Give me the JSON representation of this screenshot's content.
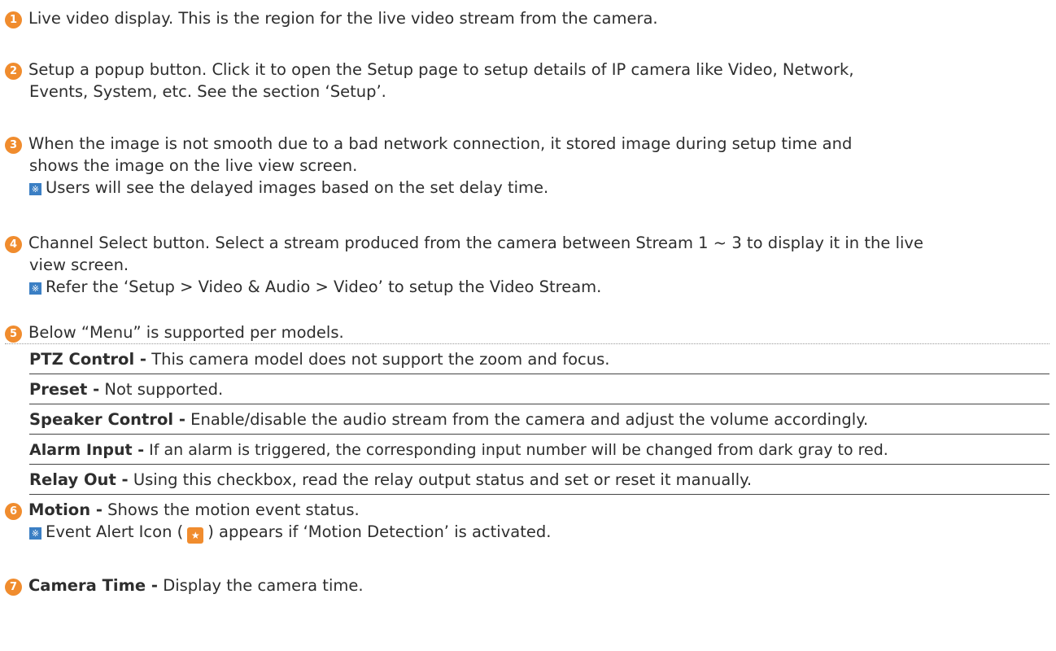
{
  "colors": {
    "number_badge": "#f08c2e",
    "note_icon": "#3b7fc4",
    "alert_icon": "#f08c2e",
    "text": "#2e2e2e"
  },
  "icons": {
    "number_badge": "circled-number",
    "note": "note-mark-icon",
    "event_alert": "motion-alert-icon"
  },
  "items": [
    {
      "num": "1",
      "text": "Live video display. This is the region for the live video stream from the camera."
    },
    {
      "num": "2",
      "lines": [
        "Setup a popup button. Click it to open the Setup page to setup details of IP camera like Video, Network,",
        "Events, System, etc. See the section ‘Setup’."
      ]
    },
    {
      "num": "3",
      "lines": [
        "When the image is not smooth due to a bad network connection, it stored image during setup time and",
        "shows the image on the live view screen."
      ],
      "note": "Users will see the delayed images based on the set delay time."
    },
    {
      "num": "4",
      "lines": [
        "Channel Select button. Select a stream produced from the camera between Stream 1 ~ 3 to display it in the live",
        "view screen."
      ],
      "note": "Refer the ‘Setup > Video & Audio > Video’ to setup the Video Stream."
    },
    {
      "num": "5",
      "text": "Below “Menu” is supported per models."
    },
    {
      "num": "6",
      "title": "Motion -",
      "text": " Shows the motion event status.",
      "note_before": "Event Alert Icon (",
      "note_after": ") appears if ‘Motion Detection’ is activated."
    },
    {
      "num": "7",
      "title": "Camera Time -",
      "text": " Display the camera time."
    }
  ],
  "menu": [
    {
      "title": "PTZ Control -",
      "text": " This camera model does not support the zoom and focus."
    },
    {
      "title": "Preset -",
      "text": " Not supported."
    },
    {
      "title": "Speaker Control -",
      "text": " Enable/disable the audio stream from the camera and adjust the volume accordingly."
    },
    {
      "title": "Alarm Input -",
      "text": " If an alarm is triggered, the corresponding input number will be changed from dark gray to red."
    },
    {
      "title": "Relay Out -",
      "text": " Using this checkbox, read the relay output status and set or reset it manually."
    }
  ]
}
